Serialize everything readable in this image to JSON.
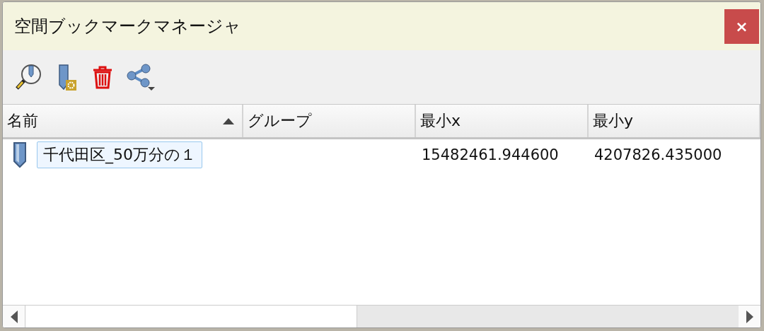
{
  "window": {
    "title": "空間ブックマークマネージャ",
    "close": "×"
  },
  "toolbar": [
    {
      "kind": "zoom"
    },
    {
      "kind": "add"
    },
    {
      "kind": "delete"
    },
    {
      "kind": "share"
    }
  ],
  "table": {
    "columns": [
      {
        "label": "名前",
        "sorted": true
      },
      {
        "label": "グループ",
        "sorted": false
      },
      {
        "label": "最小x",
        "sorted": false
      },
      {
        "label": "最小y",
        "sorted": false
      }
    ],
    "rows": [
      {
        "cells": [
          "千代田区_50万分の１",
          "",
          "15482461.944600",
          "4207826.435000"
        ],
        "editing": true
      }
    ]
  }
}
